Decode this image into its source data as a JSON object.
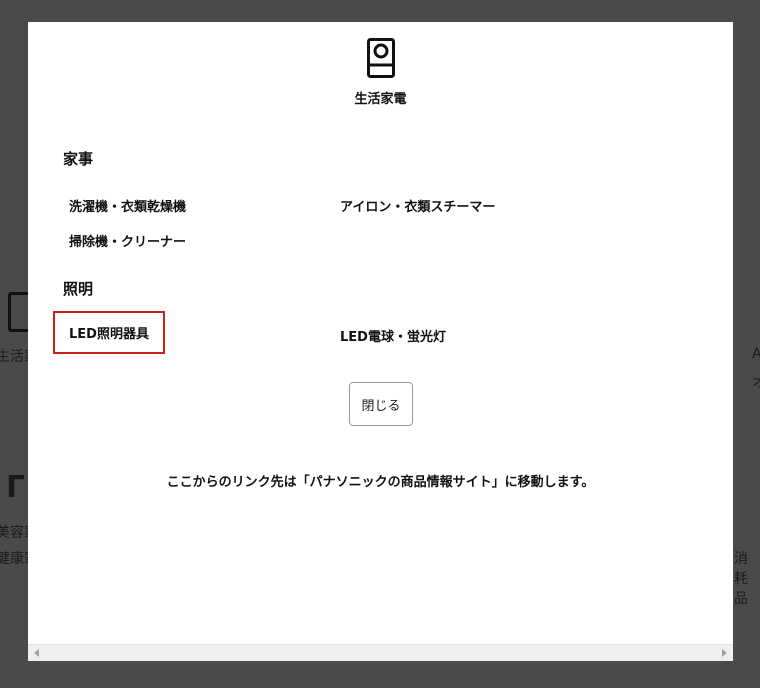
{
  "category": {
    "icon": "appliance-icon",
    "title": "生活家電"
  },
  "sections": [
    {
      "title": "家事",
      "links": [
        "洗濯機・衣類乾燥機",
        "アイロン・衣類スチーマー",
        "掃除機・クリーナー"
      ]
    },
    {
      "title": "照明",
      "links": [
        "LED照明器具",
        "LED電球・蛍光灯"
      ]
    }
  ],
  "close_label": "閉じる",
  "note": "ここからのリンク先は「パナソニックの商品情報サイト」に移動します。",
  "background": {
    "left_labels": [
      "生活家",
      "美容家",
      "健康家"
    ],
    "right_labels": [
      "A",
      "オ",
      "消耗品"
    ]
  },
  "colors": {
    "overlay": "#4a4a4a",
    "modal": "#ffffff",
    "highlight": "#c8201c"
  }
}
